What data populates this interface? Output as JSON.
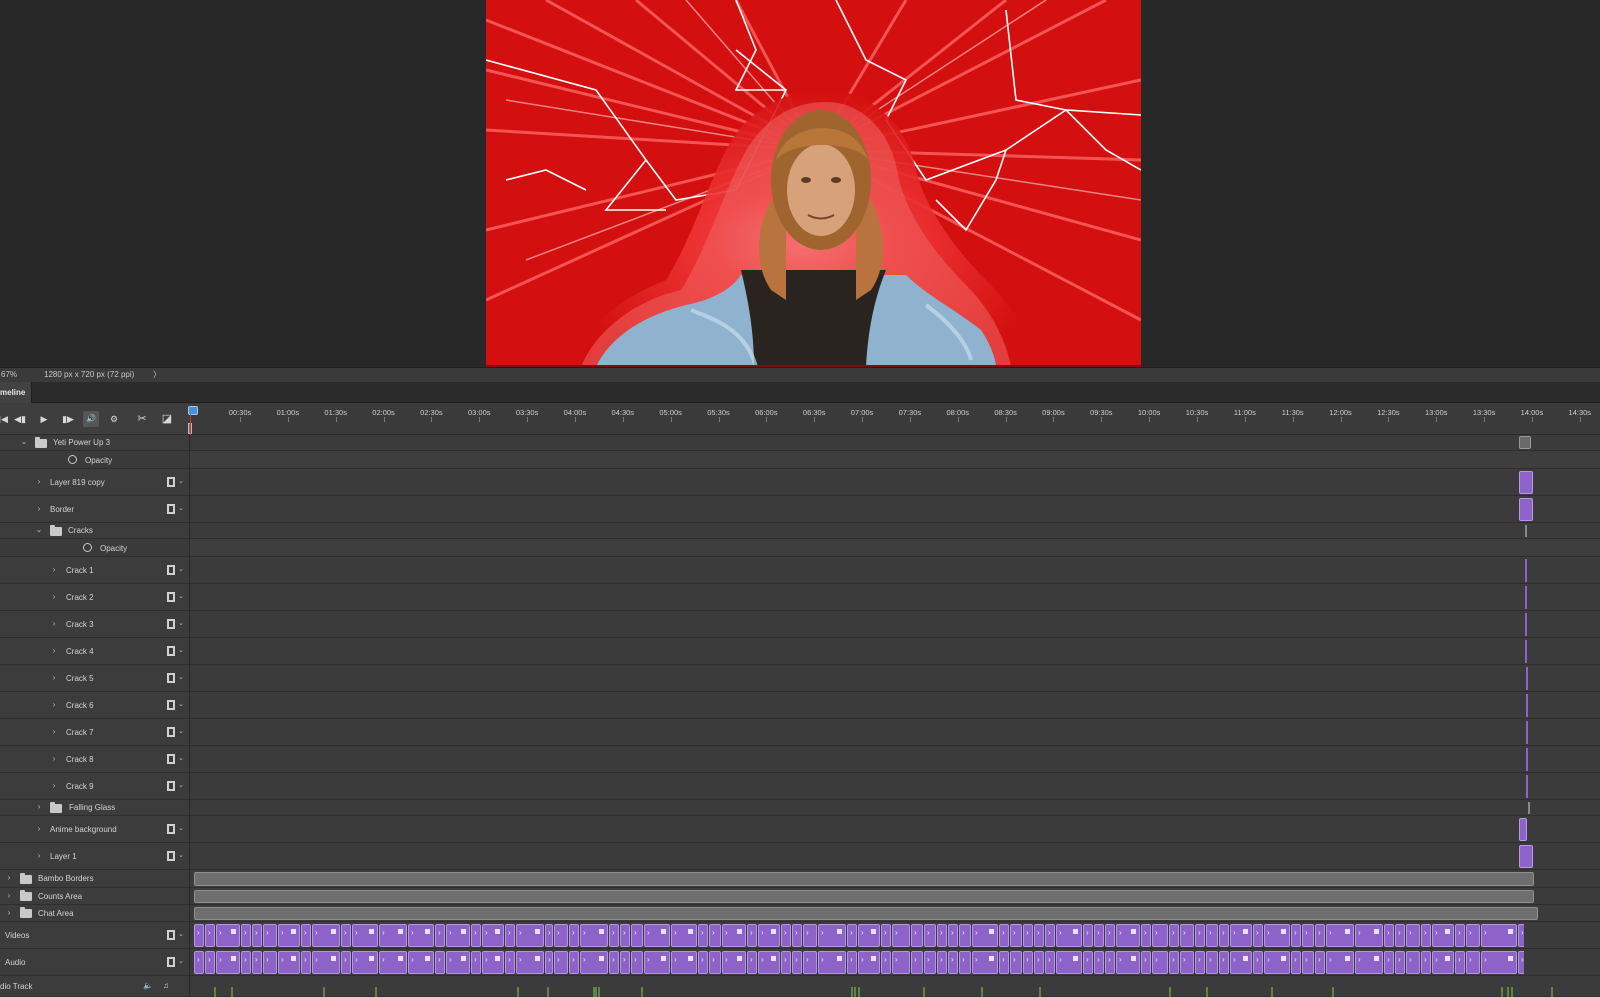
{
  "status": {
    "zoom": "67%",
    "doc_size": "1280 px x 720 px (72 ppi)",
    "arrow": "〉"
  },
  "panel": {
    "tab_label": "meline"
  },
  "ruler": {
    "labels": [
      "00:30s",
      "01:00s",
      "01:30s",
      "02:00s",
      "02:30s",
      "03:00s",
      "03:30s",
      "04:00s",
      "04:30s",
      "05:00s",
      "05:30s",
      "06:00s",
      "06:30s",
      "07:00s",
      "07:30s",
      "08:00s",
      "08:30s",
      "09:00s",
      "09:30s",
      "10:00s",
      "10:30s",
      "11:00s",
      "11:30s",
      "12:00s",
      "12:30s",
      "13:00s",
      "13:30s",
      "14:00s",
      "14:30s"
    ]
  },
  "controls": {
    "first": "▮◀",
    "prev": "◀▮",
    "play": "▶",
    "next": "▮▶",
    "audio": "🔊",
    "settings": "⚙",
    "split": "✂",
    "transition": "◪"
  },
  "layers": {
    "yeti": "Yeti Power Up 3",
    "opacity": "Opacity",
    "layer819": "Layer 819 copy",
    "border": "Border",
    "cracks": "Cracks",
    "cracks_opacity": "Opacity",
    "crack1": "Crack 1",
    "crack2": "Crack 2",
    "crack3": "Crack 3",
    "crack4": "Crack 4",
    "crack5": "Crack 5",
    "crack6": "Crack 6",
    "crack7": "Crack 7",
    "crack8": "Crack 8",
    "crack9": "Crack 9",
    "falling": "Falling Glass",
    "anime": "Anime background",
    "layer1": "Layer 1",
    "bambo": "Bambo Borders",
    "counts": "Counts Area",
    "chat": "Chat Area",
    "videos": "Videos",
    "audio": "Audio",
    "audio_track": "dio Track"
  },
  "icons": {
    "expand": "›",
    "collapse": "⌄",
    "dropdown": "⌄"
  },
  "colors": {
    "canvas_red": "#d30f0f",
    "clip_purple": "#8d62c9",
    "playhead": "#d03030",
    "panel_bg": "#3b3b3b"
  }
}
